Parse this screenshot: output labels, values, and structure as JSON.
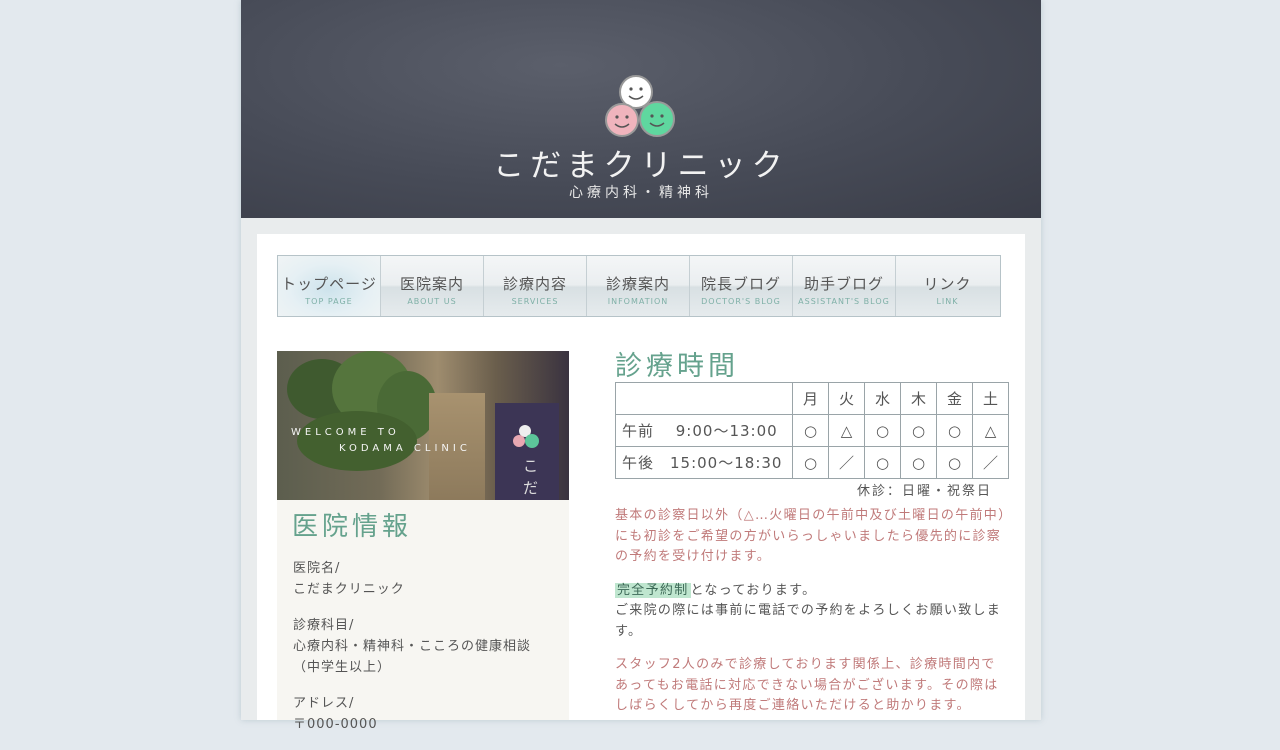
{
  "brand": {
    "name": "こだまクリニック",
    "subtitle": "心療内科・精神科"
  },
  "nav": [
    {
      "jp": "トップページ",
      "en": "TOP PAGE",
      "active": true
    },
    {
      "jp": "医院案内",
      "en": "ABOUT US"
    },
    {
      "jp": "診療内容",
      "en": "SERVICES"
    },
    {
      "jp": "診療案内",
      "en": "INFOMATION"
    },
    {
      "jp": "院長ブログ",
      "en": "DOCTOR'S BLOG"
    },
    {
      "jp": "助手ブログ",
      "en": "ASSISTANT'S BLOG"
    },
    {
      "jp": "リンク",
      "en": "LINK"
    }
  ],
  "photo": {
    "line1": "WELCOME TO",
    "line2": "KODAMA CLINIC",
    "sign_text": "こだ"
  },
  "info": {
    "title": "医院情報",
    "name_label": "医院名/",
    "name_value": "こだまクリニック",
    "dept_label": "診療科目/",
    "dept_value": "心療内科・精神科・こころの健康相談",
    "dept_note": "（中学生以上）",
    "address_label": "アドレス/",
    "address_value": "〒000-0000"
  },
  "schedule": {
    "title": "診療時間",
    "days": [
      "月",
      "火",
      "水",
      "木",
      "金",
      "土"
    ],
    "rows": [
      {
        "label": "午前　 9:00〜13:00",
        "marks": [
          "○",
          "△",
          "○",
          "○",
          "○",
          "△"
        ]
      },
      {
        "label": "午後　15:00〜18:30",
        "marks": [
          "○",
          "／",
          "○",
          "○",
          "○",
          "／"
        ]
      }
    ],
    "closed": "休診：日曜・祝祭日"
  },
  "notes": {
    "p1": "基本の診察日以外（△…火曜日の午前中及び土曜日の午前中）にも初診をご希望の方がいらっしゃいましたら優先的に診察の予約を受け付けます。",
    "highlight": "完全予約制",
    "p2_rest": "となっております。",
    "p2_line2": "ご来院の際には事前に電話での予約をよろしくお願い致します。",
    "p3": "スタッフ2人のみで診療しております関係上、診療時間内であってもお電話に対応できない場合がございます。その際はしばらくしてから再度ご連絡いただけると助かります。"
  }
}
